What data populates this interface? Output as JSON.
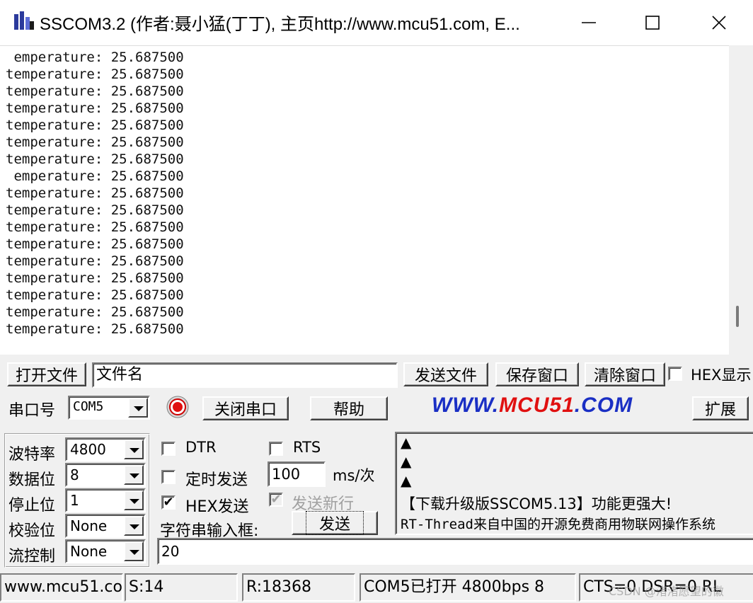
{
  "window": {
    "title": "SSCOM3.2 (作者:聂小猛(丁丁), 主页http://www.mcu51.com,  E...",
    "minimize_icon": "minimize-icon",
    "maximize_icon": "maximize-icon",
    "close_icon": "close-icon"
  },
  "output": {
    "lines": [
      " emperature: 25.687500",
      "temperature: 25.687500",
      "temperature: 25.687500",
      "temperature: 25.687500",
      "temperature: 25.687500",
      "temperature: 25.687500",
      "temperature: 25.687500",
      " emperature: 25.687500",
      "temperature: 25.687500",
      "temperature: 25.687500",
      "temperature: 25.687500",
      "temperature: 25.687500",
      "temperature: 25.687500",
      "temperature: 25.687500",
      "temperature: 25.687500",
      "temperature: 25.687500",
      "temperature: 25.687500"
    ]
  },
  "file_row": {
    "open_file": "打开文件",
    "file_name": "文件名",
    "send_file": "发送文件",
    "save_window": "保存窗口",
    "clear_window": "清除窗口",
    "hex_display": "HEX显示"
  },
  "port_row": {
    "port_label": "串口号",
    "port_value": "COM5",
    "close_port": "关闭串口",
    "help": "帮助",
    "logo_www": "WWW.",
    "logo_mcu": "MCU51",
    "logo_com": ".COM",
    "expand": "扩展"
  },
  "settings": {
    "baud_label": "波特率",
    "baud_value": "4800",
    "databits_label": "数据位",
    "databits_value": "8",
    "stopbits_label": "停止位",
    "stopbits_value": "1",
    "parity_label": "校验位",
    "parity_value": "None",
    "flow_label": "流控制",
    "flow_value": "None"
  },
  "options": {
    "dtr": "DTR",
    "rts": "RTS",
    "timed_send": "定时发送",
    "interval_value": "100",
    "interval_unit": "ms/次",
    "hex_send": "HEX发送",
    "send_newline": "发送新行",
    "input_label": "字符串输入框:",
    "send_button": "发送",
    "input_value": "20"
  },
  "ad_panel": {
    "arrows": [
      "▲",
      "▲",
      "▲"
    ],
    "line1": "【下载升级版SSCOM5.13】功能更强大!",
    "line2": "RT-Thread来自中国的开源免费商用物联网操作系统"
  },
  "status": {
    "site": "www.mcu51.com",
    "sent": "S:14",
    "received": "R:18368",
    "port_state": "COM5已打开  4800bps  8",
    "signals": "CTS=0 DSR=0 RL",
    "watermark": "CSDN @渚渚愿望的徽"
  },
  "colors": {
    "logo_blue": "#1a2fc4",
    "logo_red": "#e01010",
    "window_bg": "#f0f0f0"
  }
}
